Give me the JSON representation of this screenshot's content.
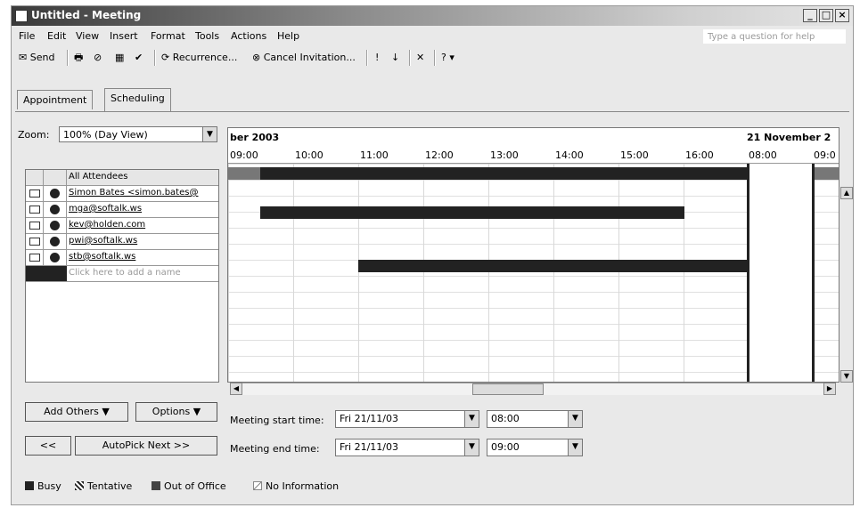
{
  "window": {
    "title": "Untitled - Meeting"
  },
  "menu": [
    "File",
    "Edit",
    "View",
    "Insert",
    "Format",
    "Tools",
    "Actions",
    "Help"
  ],
  "help_placeholder": "Type a question for help",
  "toolbar": {
    "send": "Send",
    "recurrence": "Recurrence...",
    "cancel_invitation": "Cancel Invitation..."
  },
  "tabs": [
    "Appointment",
    "Scheduling"
  ],
  "zoom": {
    "label": "Zoom:",
    "value": "100% (Day View)"
  },
  "grid": {
    "date_left": "ber 2003",
    "date_right": "21 November 2",
    "times": [
      "09:00",
      "10:00",
      "11:00",
      "12:00",
      "13:00",
      "14:00",
      "15:00",
      "16:00",
      "08:00",
      "09:0"
    ]
  },
  "attendees": {
    "header": "All Attendees",
    "rows": [
      {
        "name": "Simon Bates <simon.bates@"
      },
      {
        "name": "mga@softalk.ws"
      },
      {
        "name": "kev@holden.com"
      },
      {
        "name": "pwi@softalk.ws"
      },
      {
        "name": "stb@softalk.ws"
      }
    ],
    "add_placeholder": "Click here to add a name"
  },
  "buttons": {
    "add_others": "Add Others",
    "options": "Options",
    "prev": "<<",
    "autopick": "AutoPick Next >>"
  },
  "meeting": {
    "start_label": "Meeting start time:",
    "start_date": "Fri 21/11/03",
    "start_time": "08:00",
    "end_label": "Meeting end time:",
    "end_date": "Fri 21/11/03",
    "end_time": "09:00"
  },
  "legend": [
    "Busy",
    "Tentative",
    "Out of Office",
    "No Information"
  ]
}
